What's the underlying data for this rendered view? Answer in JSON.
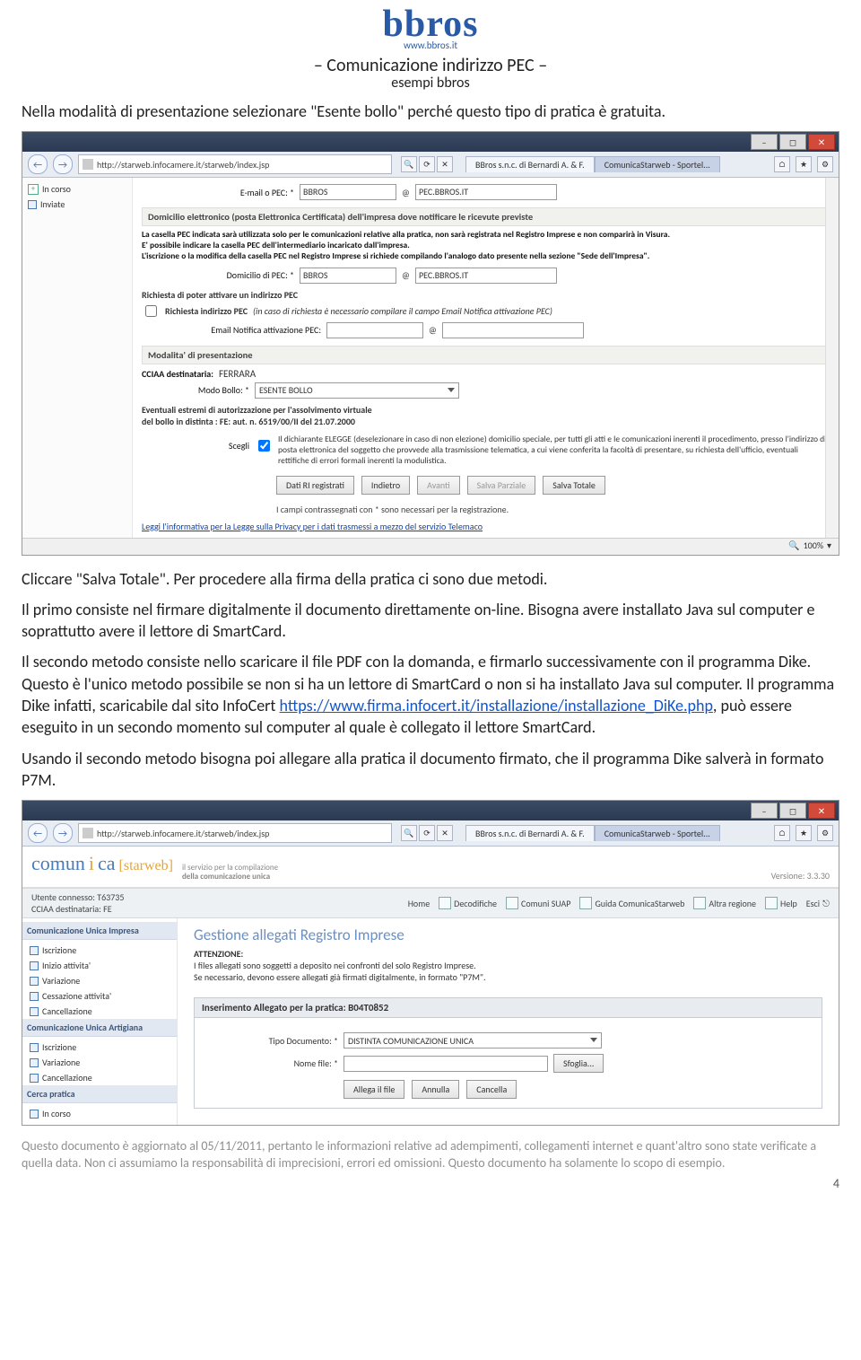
{
  "header": {
    "logo_main": "bbros",
    "logo_url": "www.bbros.it",
    "title_line1": "– Comunicazione indirizzo PEC –",
    "title_line2": "esempi bbros"
  },
  "para_intro": "Nella modalità di presentazione selezionare \"Esente bollo\" perché questo tipo di pratica è gratuita.",
  "screenshot1": {
    "url": "http://starweb.infocamere.it/starweb/index.jsp",
    "tab1": "BBros s.n.c. di Bernardi A. & F.",
    "tab2": "ComunicaStarweb - Sportel...",
    "sidebar_items": [
      "In corso",
      "Inviate"
    ],
    "email_label": "E-mail o PEC: *",
    "email_user": "BBROS",
    "email_domain": "PEC.BBROS.IT",
    "sec1_title": "Domicilio elettronico (posta Elettronica Certificata) dell'impresa dove notificare le ricevute previste",
    "sec1_note_l1": "La casella PEC indicata sarà utilizzata solo per le comunicazioni relative alla pratica, non sarà registrata nel Registro Imprese e non comparirà in Visura.",
    "sec1_note_l2": "E' possibile indicare la casella PEC dell'intermediario incaricato dall'impresa.",
    "sec1_note_l3": "L'iscrizione o la modifica della casella PEC nel Registro Imprese si richiede compilando l'analogo dato presente nella sezione \"Sede dell'Impresa\".",
    "dom_label": "Domicilio di PEC: *",
    "dom_user": "BBROS",
    "dom_domain": "PEC.BBROS.IT",
    "richiesta_head": "Richiesta di poter attivare un indirizzo PEC",
    "chk_label": "Richiesta indirizzo PEC",
    "chk_hint": "(in caso di richiesta è necessario compilare il campo Email Notifica attivazione PEC)",
    "notif_label": "Email Notifica attivazione PEC:",
    "sec2_title": "Modalita' di presentazione",
    "cciaa_label": "CCIAA destinataria:",
    "cciaa_value": "FERRARA",
    "bollo_label": "Modo Bollo: *",
    "bollo_value": "ESENTE BOLLO",
    "estremi_l1": "Eventuali estremi di autorizzazione per l'assolvimento virtuale",
    "estremi_l2": "del bollo in distinta : FE: aut. n. 6519/00/II del 21.07.2000",
    "scegli_label": "Scegli",
    "scegli_text": "Il dichiarante ELEGGE (deselezionare in caso di non elezione) domicilio speciale, per tutti gli atti e le comunicazioni inerenti il procedimento, presso l'indirizzo di posta elettronica del soggetto che provvede alla trasmissione telematica, a cui viene conferita la facoltà di presentare, su richiesta dell'ufficio, eventuali rettifiche di errori formali inerenti la modulistica.",
    "btn_dati": "Dati RI registrati",
    "btn_indietro": "Indietro",
    "btn_avanti": "Avanti",
    "btn_salva_parz": "Salva Parziale",
    "btn_salva_tot": "Salva Totale",
    "required_note": "I campi contrassegnati con * sono necessari per la registrazione.",
    "privacy": "Leggi l'informativa per la Legge sulla Privacy per i dati trasmessi a mezzo del servizio Telemaco",
    "zoom": "100%"
  },
  "mid_text": {
    "p1_l1": "Cliccare \"Salva Totale\". Per procedere alla firma della pratica ci sono due metodi.",
    "p2": "Il primo consiste nel firmare digitalmente il documento direttamente on-line. Bisogna avere installato Java sul computer e soprattutto avere il lettore di SmartCard.",
    "p3a": "Il secondo metodo consiste nello scaricare il file PDF con la domanda, e firmarlo successivamente con il programma Dike. Questo è l'unico metodo possibile se non si ha un lettore di SmartCard o non si ha installato Java sul computer. Il programma Dike infatti, scaricabile dal sito InfoCert ",
    "p3_link": "https://www.firma.infocert.it/installazione/installazione_DiKe.php",
    "p3b": ", può essere eseguito in un secondo momento sul computer al quale è collegato il lettore SmartCard.",
    "p4": "Usando il secondo metodo bisogna poi allegare alla pratica il documento firmato, che il programma Dike salverà in formato P7M."
  },
  "screenshot2": {
    "com_word": "comun",
    "com_i": "i",
    "com_ca": "ca",
    "starweb": "[starweb]",
    "tagline_l1": "il servizio per la compilazione",
    "tagline_l2": "della comunicazione unica",
    "version": "Versione: 3.3.30",
    "user_l1": "Utente connesso: T63735",
    "user_l2": "CCIAA destinataria: FE",
    "ub_home": "Home",
    "ub_decod": "Decodifiche",
    "ub_suap": "Comuni SUAP",
    "ub_guida": "Guida ComunicaStarweb",
    "ub_altra": "Altra regione",
    "ub_help": "Help",
    "ub_esci": "Esci",
    "side_h1": "Comunicazione Unica Impresa",
    "side_items1": [
      "Iscrizione",
      "Inizio attivita'",
      "Variazione",
      "Cessazione attivita'",
      "Cancellazione"
    ],
    "side_h2": "Comunicazione Unica Artigiana",
    "side_items2": [
      "Iscrizione",
      "Variazione",
      "Cancellazione"
    ],
    "side_h3": "Cerca pratica",
    "side_item3": "In corso",
    "title2": "Gestione allegati Registro Imprese",
    "attn_b": "ATTENZIONE:",
    "attn_l1": "I files allegati sono soggetti a deposito nei confronti del solo Registro Imprese.",
    "attn_l2": "Se necessario, devono essere allegati già firmati digitalmente, in formato \"P7M\".",
    "panel_title_a": "Inserimento Allegato per la pratica: ",
    "panel_title_b": "B04T0852",
    "tipo_label": "Tipo Documento: *",
    "tipo_value": "DISTINTA COMUNICAZIONE UNICA",
    "nome_label": "Nome file: *",
    "btn_sfoglia": "Sfoglia...",
    "btn_allega": "Allega il file",
    "btn_annulla": "Annulla",
    "btn_cancella": "Cancella"
  },
  "footer": {
    "disclaimer": "Questo documento è aggiornato al 05/11/2011, pertanto le informazioni relative ad adempimenti, collegamenti internet e quant'altro sono state verificate a quella data. Non ci assumiamo la responsabilità di imprecisioni, errori ed omissioni. Questo documento ha solamente lo scopo di esempio.",
    "page": "4"
  }
}
